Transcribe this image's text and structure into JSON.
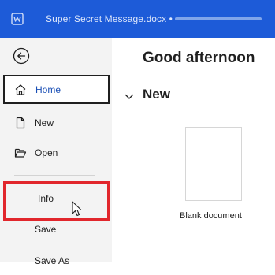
{
  "titlebar": {
    "app_icon": "word-icon",
    "document_title": "Super Secret Message.docx •"
  },
  "sidebar": {
    "back_icon": "back-arrow-icon",
    "items": [
      {
        "id": "home",
        "label": "Home",
        "icon": "home-icon"
      },
      {
        "id": "new",
        "label": "New",
        "icon": "new-document-icon"
      },
      {
        "id": "open",
        "label": "Open",
        "icon": "open-folder-icon"
      },
      {
        "id": "info",
        "label": "Info"
      },
      {
        "id": "save",
        "label": "Save"
      },
      {
        "id": "saveas",
        "label": "Save As"
      }
    ],
    "selected": "home",
    "highlighted": "info"
  },
  "main": {
    "greeting": "Good afternoon",
    "new_section_label": "New",
    "new_section_icon": "chevron-down-icon",
    "templates": [
      {
        "label": "Blank document"
      }
    ]
  },
  "colors": {
    "titlebar": "#1d5bd8",
    "sidebar": "#f3f3f3",
    "highlight_box": "#e1262c",
    "selected_text": "#1a4fb5"
  }
}
